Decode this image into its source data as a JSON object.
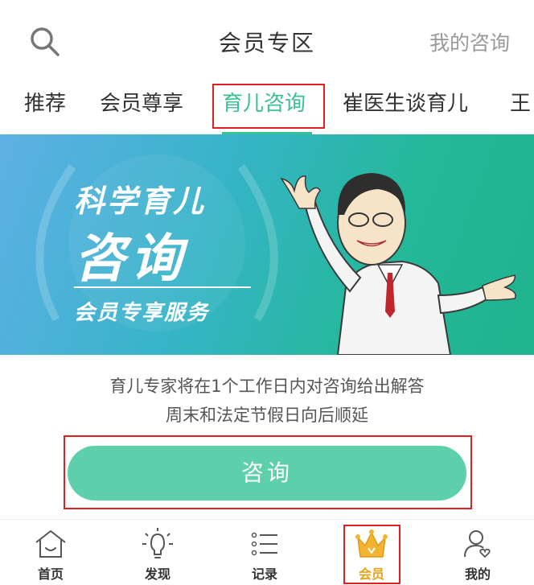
{
  "header": {
    "title": "会员专区",
    "my_consult": "我的咨询"
  },
  "tabs": [
    {
      "label": "推荐"
    },
    {
      "label": "会员尊享"
    },
    {
      "label": "育儿咨询"
    },
    {
      "label": "崔医生谈育儿"
    },
    {
      "label": "王"
    }
  ],
  "banner": {
    "line1": "科学育儿",
    "line2": "咨询",
    "line3": "会员专享服务"
  },
  "info": {
    "line1": "育儿专家将在1个工作日内对咨询给出解答",
    "line2": "周末和法定节假日向后顺延"
  },
  "consult_button": "咨询",
  "bottom_nav": [
    {
      "label": "首页",
      "icon": "home-icon"
    },
    {
      "label": "发现",
      "icon": "lightbulb-icon"
    },
    {
      "label": "记录",
      "icon": "list-icon"
    },
    {
      "label": "会员",
      "icon": "crown-icon"
    },
    {
      "label": "我的",
      "icon": "profile-icon"
    }
  ],
  "colors": {
    "accent": "#3cbf95",
    "button": "#5dcfab",
    "member_gold": "#e6a21c",
    "highlight_box": "#e02020"
  }
}
